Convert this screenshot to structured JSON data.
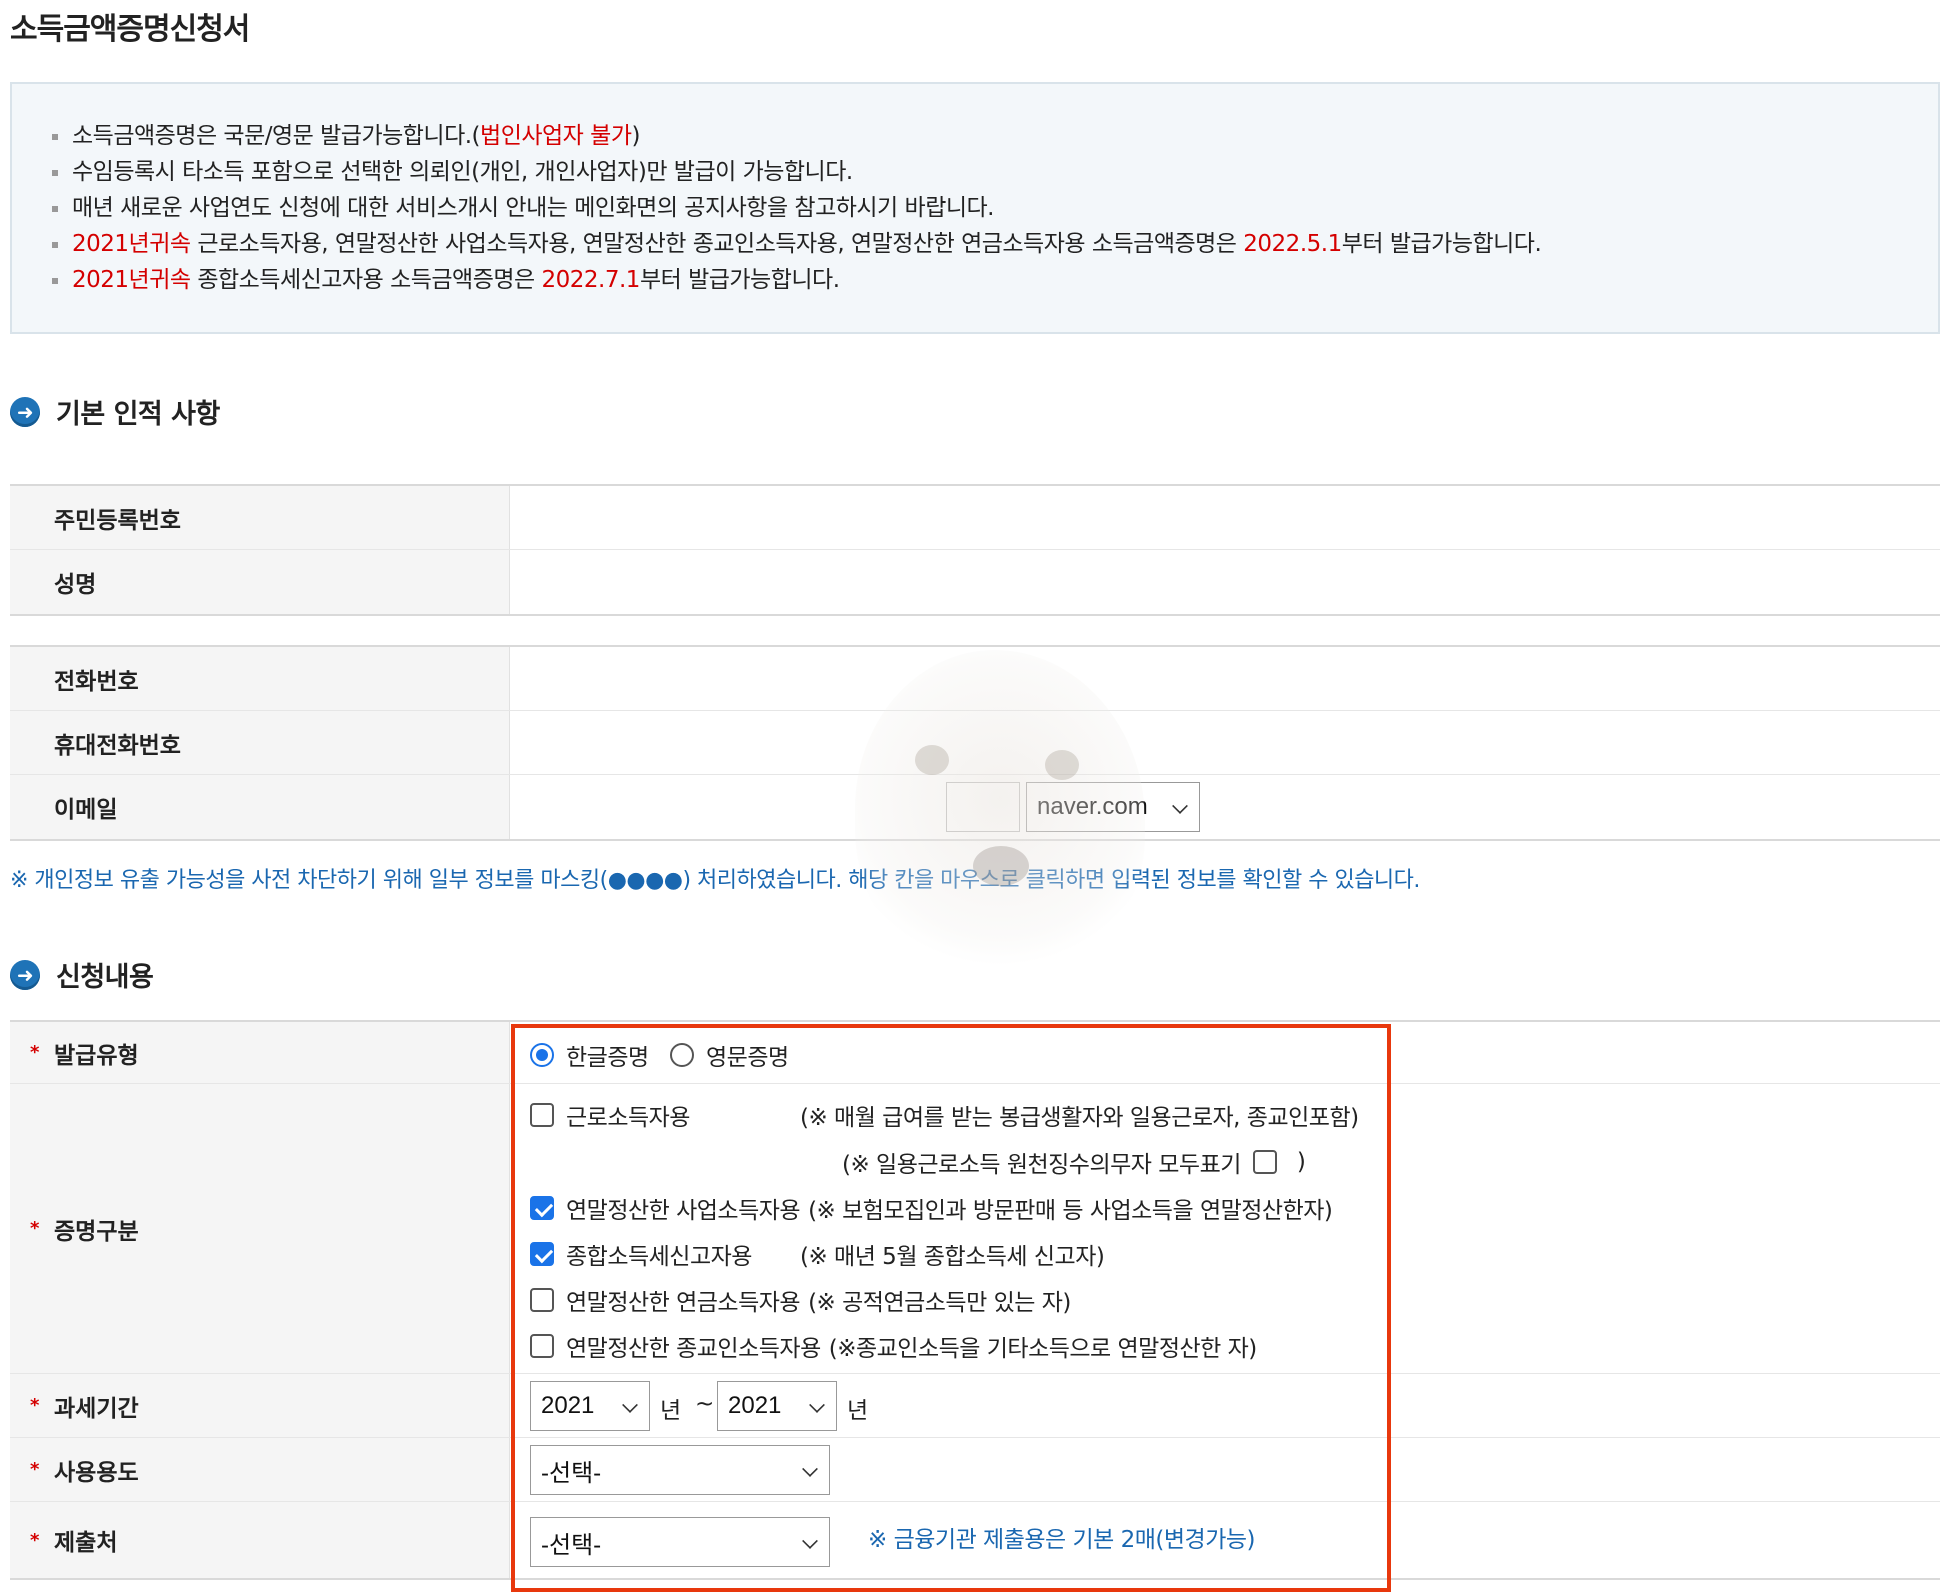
{
  "page": {
    "title": "소득금액증명신청서"
  },
  "notice": {
    "line1": "소득금액증명은 국문/영문 발급가능합니다.(",
    "line1_red": "법인사업자 불가",
    "line1_end": ")",
    "line2": "수임등록시 타소득 포함으로 선택한 의뢰인(개인, 개인사업자)만 발급이 가능합니다.",
    "line3": "매년 새로운 사업연도 신청에 대한 서비스개시 안내는 메인화면의 공지사항을 참고하시기 바랍니다.",
    "line4_red": "2021년귀속",
    "line4": " 근로소득자용, 연말정산한 사업소득자용, 연말정산한 종교인소득자용, 연말정산한 연금소득자용 소득금액증명은 ",
    "line4_date": "2022.5.1",
    "line4_end": "부터 발급가능합니다.",
    "line5_red": "2021년귀속",
    "line5": " 종합소득세신고자용 소득금액증명은 ",
    "line5_date": "2022.7.1",
    "line5_end": "부터 발급가능합니다."
  },
  "basic": {
    "heading": "기본 인적 사항",
    "rrn_label": "주민등록번호",
    "name_label": "성명",
    "phone_label": "전화번호",
    "mobile_label": "휴대전화번호",
    "email_label": "이메일",
    "email_domain": "naver.com"
  },
  "mask_note": "※ 개인정보 유출 가능성을 사전 차단하기 위해 일부 정보를 마스킹(●●●●) 처리하였습니다. 해당 칸을 마우스로 클릭하면 입력된 정보를 확인할 수 있습니다.",
  "apply": {
    "heading": "신청내용",
    "required_mark": "*",
    "issue_type_label": "발급유형",
    "issue_korean": "한글증명",
    "issue_english": "영문증명",
    "issue_selected": "한글증명",
    "cert_type_label": "증명구분",
    "cert_options": [
      {
        "label": "근로소득자용",
        "note": "(※ 매월 급여를 받는 봉급생활자와 일용근로자, 종교인포함)",
        "checked": false
      },
      {
        "label": "연말정산한 사업소득자용",
        "note": "(※ 보험모집인과 방문판매 등 사업소득을 연말정산한자)",
        "checked": true
      },
      {
        "label": "종합소득세신고자용",
        "note": "(※ 매년 5월 종합소득세 신고자)",
        "checked": true
      },
      {
        "label": "연말정산한 연금소득자용",
        "note": "(※ 공적연금소득만 있는 자)",
        "checked": false
      },
      {
        "label": "연말정산한 종교인소득자용",
        "note": "(※종교인소득을 기타소득으로 연말정산한 자)",
        "checked": false
      }
    ],
    "daily_note_open": "(※ 일용근로소득 원천징수의무자 모두표기",
    "daily_note_close": ")",
    "daily_checked": false,
    "tax_period_label": "과세기간",
    "year_from": "2021",
    "year_unit": "년",
    "tilde": "~",
    "year_to": "2021",
    "usage_label": "사용용도",
    "usage_value": "-선택-",
    "submit_label": "제출처",
    "submit_value": "-선택-",
    "submit_note": "※ 금융기관 제출용은 기본 2매(변경가능)"
  }
}
